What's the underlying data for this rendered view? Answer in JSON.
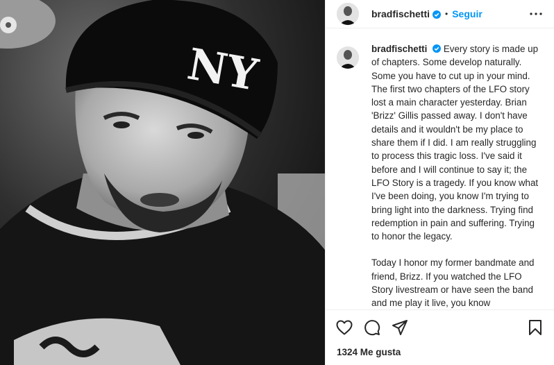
{
  "post": {
    "username": "bradfischetti",
    "dot": "•",
    "follow_label": "Seguir",
    "verified_icon": "verified-badge-icon",
    "caption_paragraphs": [
      "Every story is made up of chapters. Some develop naturally. Some you have to cut up in your mind. The first two chapters of the LFO story lost a main character yesterday. Brian 'Brizz' Gillis passed away. I don't have details and it wouldn't be my place to share them if I did. I am really struggling to process this tragic loss. I've said it before and I will continue to say it; the LFO Story is a tragedy. If you know what I've been doing, you know I'm trying to bring light into the darkness. Trying find redemption in pain and suffering. Trying to honor the legacy.",
      "Today I honor my former bandmate and friend, Brizz. If you watched the LFO Story livestream or have seen the band and me play it live, you know"
    ],
    "likes_text": "1324 Me gusta",
    "accent_color": "#0095f6",
    "photo_hat_logo": "NY"
  },
  "icons": {
    "more": "more-options-icon",
    "like": "heart-icon",
    "comment": "comment-icon",
    "share": "share-icon",
    "save": "bookmark-icon"
  }
}
